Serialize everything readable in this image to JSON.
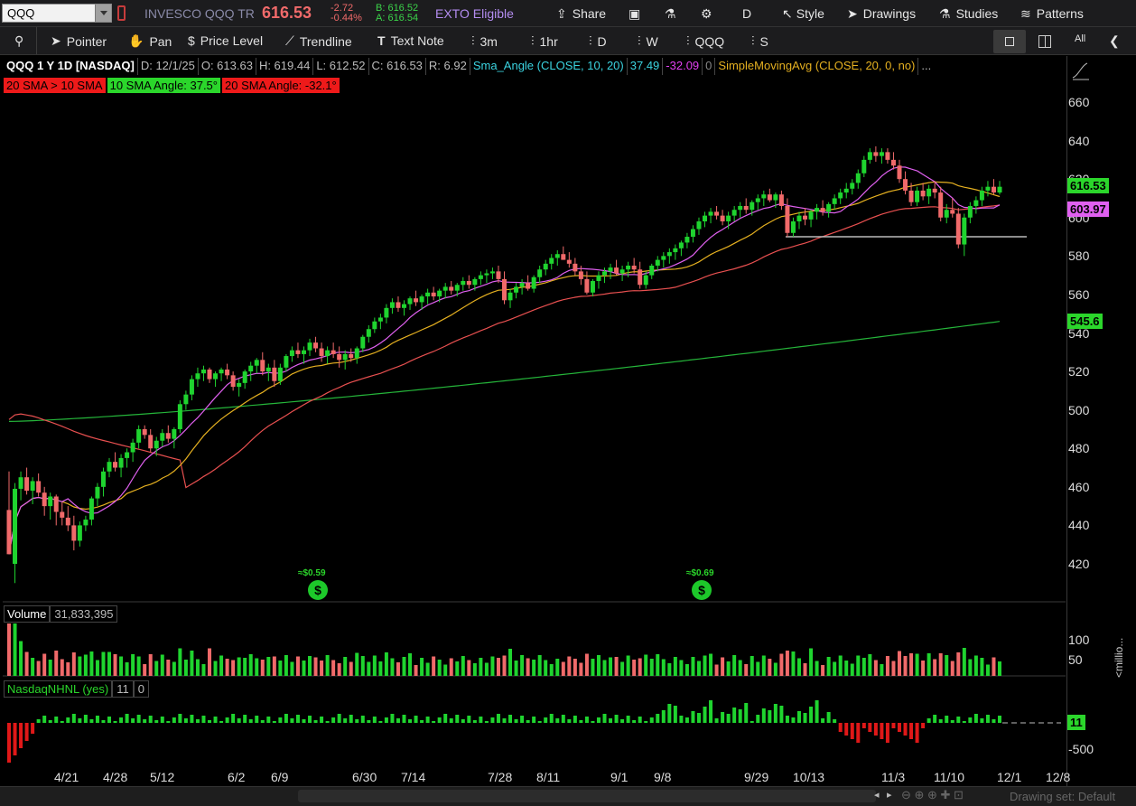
{
  "header": {
    "symbol": "QQQ",
    "description": "INVESCO QQQ TR",
    "last": "616.53",
    "change": "-2.72",
    "change_pct": "-0.44%",
    "bid": "B: 616.52",
    "ask": "A: 616.54",
    "exto": "EXTO Eligible",
    "share": "Share",
    "period": "D",
    "style": "Style",
    "drawings": "Drawings",
    "studies": "Studies",
    "patterns": "Patterns"
  },
  "toolbar": {
    "pointer": "Pointer",
    "pan": "Pan",
    "price_level": "Price Level",
    "trendline": "Trendline",
    "text_note": "Text Note",
    "i3m": "3m",
    "i1hr": "1hr",
    "iD": "D",
    "iW": "W",
    "iQQQ": "QQQ",
    "iS": "S",
    "all": "All"
  },
  "infoline": {
    "title": "QQQ 1 Y 1D [NASDAQ]",
    "date": "D: 12/1/25",
    "open": "O: 613.63",
    "high": "H: 619.44",
    "low": "L: 612.52",
    "close": "C: 616.53",
    "range": "R: 6.92",
    "study": "Sma_Angle (CLOSE, 10, 20)",
    "study_v1": "37.49",
    "study_v2": "-32.09",
    "study_v3": "0",
    "sma": "SimpleMovingAvg (CLOSE, 20, 0, no)",
    "more": "..."
  },
  "badges": {
    "b1": "20 SMA > 10 SMA",
    "b2": "10 SMA Angle: 37.5°",
    "b3": "20 SMA Angle: -32.1°"
  },
  "price_axis": [
    "660",
    "640",
    "620",
    "600",
    "580",
    "560",
    "540",
    "520",
    "500",
    "480",
    "460",
    "440",
    "420"
  ],
  "price_tags": {
    "last": "616.53",
    "sma": "603.97",
    "sma200": "545.6"
  },
  "dividends": [
    "≈$0.59",
    "≈$0.69"
  ],
  "dividend_icon": "$",
  "volume": {
    "label": "Volume",
    "value": "31,833,395",
    "axis": [
      "100",
      "50"
    ],
    "unit": "<millio..."
  },
  "nhnl": {
    "label": "NasdaqNHNL (yes)",
    "value": "11",
    "zero": "0",
    "axis": [
      "-500"
    ],
    "tag": "11"
  },
  "x_axis": [
    "4/21",
    "4/28",
    "5/12",
    "6/2",
    "6/9",
    "6/30",
    "7/14",
    "7/28",
    "8/11",
    "9/1",
    "9/8",
    "9/29",
    "10/13",
    "11/3",
    "11/10",
    "12/1",
    "12/8"
  ],
  "footer": {
    "drawing_set": "Drawing set: Default"
  },
  "colors": {
    "up": "#1fd42f",
    "down": "#f06a6a",
    "sma10": "#e060f0",
    "sma20": "#e5b020",
    "sma50": "#e85050",
    "sma200": "#25b53a",
    "cyan": "#3bd3e0"
  },
  "chart_data": {
    "type": "candlestick",
    "ylim": [
      410,
      670
    ],
    "candles": [
      [
        448,
        468,
        446,
        425
      ],
      [
        420,
        462,
        410,
        459
      ],
      [
        459,
        468,
        453,
        465
      ],
      [
        465,
        470,
        456,
        458
      ],
      [
        458,
        465,
        451,
        463
      ],
      [
        463,
        467,
        455,
        457
      ],
      [
        457,
        460,
        445,
        450
      ],
      [
        450,
        457,
        443,
        455
      ],
      [
        455,
        456,
        440,
        447
      ],
      [
        447,
        452,
        440,
        444
      ],
      [
        444,
        450,
        437,
        440
      ],
      [
        440,
        445,
        427,
        432
      ],
      [
        432,
        442,
        429,
        440
      ],
      [
        440,
        445,
        437,
        443
      ],
      [
        443,
        455,
        440,
        454
      ],
      [
        454,
        462,
        450,
        460
      ],
      [
        460,
        470,
        455,
        468
      ],
      [
        468,
        475,
        465,
        473
      ],
      [
        473,
        478,
        468,
        470
      ],
      [
        470,
        477,
        465,
        475
      ],
      [
        475,
        480,
        470,
        478
      ],
      [
        478,
        485,
        473,
        483
      ],
      [
        483,
        492,
        480,
        490
      ],
      [
        490,
        492,
        485,
        487
      ],
      [
        487,
        490,
        478,
        480
      ],
      [
        480,
        486,
        476,
        484
      ],
      [
        484,
        490,
        481,
        488
      ],
      [
        488,
        492,
        483,
        485
      ],
      [
        485,
        491,
        480,
        490
      ],
      [
        490,
        505,
        488,
        503
      ],
      [
        503,
        510,
        500,
        508
      ],
      [
        508,
        518,
        505,
        516
      ],
      [
        516,
        522,
        512,
        519
      ],
      [
        519,
        523,
        515,
        521
      ],
      [
        521,
        522,
        514,
        516
      ],
      [
        516,
        520,
        512,
        519
      ],
      [
        519,
        522,
        515,
        521
      ],
      [
        521,
        524,
        516,
        518
      ],
      [
        518,
        520,
        510,
        512
      ],
      [
        512,
        516,
        507,
        514
      ],
      [
        514,
        521,
        511,
        520
      ],
      [
        520,
        525,
        515,
        523
      ],
      [
        523,
        527,
        519,
        526
      ],
      [
        526,
        530,
        518,
        520
      ],
      [
        520,
        524,
        515,
        522
      ],
      [
        522,
        526,
        512,
        515
      ],
      [
        515,
        524,
        513,
        522
      ],
      [
        522,
        529,
        520,
        528
      ],
      [
        528,
        533,
        525,
        531
      ],
      [
        531,
        535,
        527,
        529
      ],
      [
        529,
        533,
        524,
        531
      ],
      [
        531,
        537,
        528,
        535
      ],
      [
        535,
        538,
        530,
        532
      ],
      [
        532,
        535,
        525,
        528
      ],
      [
        528,
        533,
        524,
        531
      ],
      [
        531,
        535,
        527,
        529
      ],
      [
        529,
        533,
        522,
        526
      ],
      [
        526,
        531,
        521,
        529
      ],
      [
        529,
        532,
        525,
        527
      ],
      [
        527,
        533,
        524,
        532
      ],
      [
        532,
        539,
        530,
        538
      ],
      [
        538,
        544,
        535,
        542
      ],
      [
        542,
        548,
        540,
        546
      ],
      [
        546,
        550,
        542,
        548
      ],
      [
        548,
        555,
        545,
        553
      ],
      [
        553,
        558,
        550,
        556
      ],
      [
        556,
        559,
        551,
        553
      ],
      [
        553,
        557,
        549,
        555
      ],
      [
        555,
        559,
        552,
        558
      ],
      [
        558,
        562,
        554,
        556
      ],
      [
        556,
        560,
        552,
        559
      ],
      [
        559,
        563,
        555,
        561
      ],
      [
        561,
        564,
        557,
        559
      ],
      [
        559,
        563,
        556,
        562
      ],
      [
        562,
        566,
        558,
        564
      ],
      [
        564,
        567,
        560,
        562
      ],
      [
        562,
        566,
        559,
        565
      ],
      [
        565,
        569,
        562,
        567
      ],
      [
        567,
        570,
        563,
        565
      ],
      [
        565,
        569,
        562,
        568
      ],
      [
        568,
        572,
        565,
        570
      ],
      [
        570,
        573,
        566,
        571
      ],
      [
        571,
        574,
        568,
        572
      ],
      [
        572,
        575,
        566,
        568
      ],
      [
        568,
        572,
        555,
        557
      ],
      [
        557,
        563,
        553,
        561
      ],
      [
        561,
        566,
        558,
        564
      ],
      [
        564,
        568,
        560,
        566
      ],
      [
        566,
        570,
        562,
        563
      ],
      [
        563,
        570,
        561,
        569
      ],
      [
        569,
        575,
        566,
        573
      ],
      [
        573,
        578,
        570,
        576
      ],
      [
        576,
        581,
        573,
        579
      ],
      [
        579,
        583,
        575,
        581
      ],
      [
        581,
        585,
        578,
        578
      ],
      [
        578,
        582,
        574,
        576
      ],
      [
        576,
        579,
        570,
        572
      ],
      [
        572,
        575,
        565,
        568
      ],
      [
        568,
        572,
        560,
        561
      ],
      [
        561,
        568,
        559,
        567
      ],
      [
        567,
        572,
        563,
        570
      ],
      [
        570,
        574,
        566,
        572
      ],
      [
        572,
        576,
        568,
        574
      ],
      [
        574,
        578,
        570,
        571
      ],
      [
        571,
        575,
        567,
        573
      ],
      [
        573,
        577,
        569,
        575
      ],
      [
        575,
        579,
        571,
        573
      ],
      [
        573,
        577,
        563,
        565
      ],
      [
        565,
        572,
        563,
        570
      ],
      [
        570,
        576,
        568,
        575
      ],
      [
        575,
        580,
        572,
        578
      ],
      [
        578,
        582,
        574,
        580
      ],
      [
        580,
        584,
        576,
        582
      ],
      [
        582,
        586,
        578,
        584
      ],
      [
        584,
        588,
        580,
        587
      ],
      [
        587,
        592,
        584,
        590
      ],
      [
        590,
        596,
        587,
        594
      ],
      [
        594,
        600,
        591,
        598
      ],
      [
        598,
        603,
        595,
        601
      ],
      [
        601,
        605,
        597,
        603
      ],
      [
        603,
        606,
        599,
        601
      ],
      [
        601,
        604,
        596,
        598
      ],
      [
        598,
        603,
        594,
        601
      ],
      [
        601,
        606,
        598,
        604
      ],
      [
        604,
        608,
        600,
        606
      ],
      [
        606,
        610,
        602,
        604
      ],
      [
        604,
        609,
        601,
        608
      ],
      [
        608,
        612,
        604,
        610
      ],
      [
        610,
        614,
        606,
        612
      ],
      [
        612,
        615,
        608,
        609
      ],
      [
        609,
        613,
        605,
        612
      ],
      [
        612,
        614,
        604,
        606
      ],
      [
        606,
        610,
        590,
        592
      ],
      [
        592,
        600,
        590,
        598
      ],
      [
        598,
        603,
        594,
        601
      ],
      [
        601,
        605,
        596,
        599
      ],
      [
        599,
        604,
        595,
        603
      ],
      [
        603,
        607,
        599,
        605
      ],
      [
        605,
        609,
        601,
        603
      ],
      [
        603,
        608,
        600,
        607
      ],
      [
        607,
        612,
        604,
        610
      ],
      [
        610,
        615,
        607,
        613
      ],
      [
        613,
        618,
        610,
        615
      ],
      [
        615,
        620,
        612,
        618
      ],
      [
        618,
        625,
        615,
        623
      ],
      [
        623,
        632,
        621,
        630
      ],
      [
        630,
        636,
        628,
        634
      ],
      [
        634,
        637,
        629,
        632
      ],
      [
        632,
        636,
        628,
        634
      ],
      [
        634,
        636,
        628,
        630
      ],
      [
        630,
        634,
        625,
        627
      ],
      [
        627,
        630,
        618,
        620
      ],
      [
        620,
        624,
        612,
        614
      ],
      [
        614,
        618,
        606,
        608
      ],
      [
        608,
        616,
        606,
        614
      ],
      [
        614,
        618,
        609,
        611
      ],
      [
        611,
        617,
        607,
        615
      ],
      [
        615,
        619,
        610,
        613
      ],
      [
        613,
        616,
        598,
        600
      ],
      [
        600,
        607,
        597,
        604
      ],
      [
        604,
        610,
        600,
        602
      ],
      [
        602,
        605,
        584,
        586
      ],
      [
        586,
        602,
        580,
        600
      ],
      [
        600,
        608,
        597,
        606
      ],
      [
        606,
        611,
        602,
        609
      ],
      [
        609,
        616,
        606,
        614
      ],
      [
        614,
        619,
        611,
        616
      ],
      [
        616,
        620,
        612,
        613
      ],
      [
        613,
        619,
        612,
        616
      ]
    ]
  }
}
